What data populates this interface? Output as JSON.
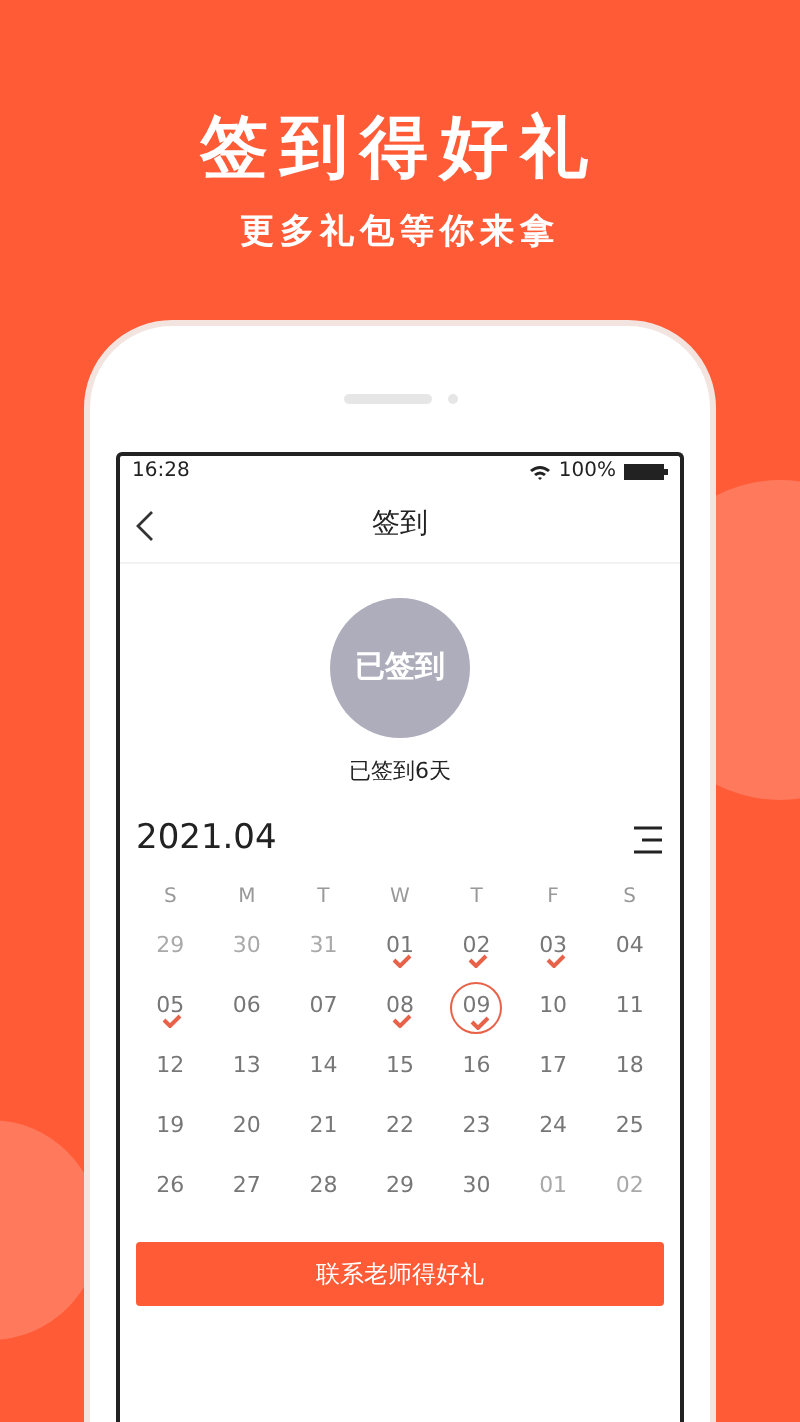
{
  "banner": {
    "title": "签到得好礼",
    "subtitle": "更多礼包等你来拿"
  },
  "status_bar": {
    "time": "16:28",
    "battery": "100%"
  },
  "nav": {
    "title": "签到"
  },
  "checkin": {
    "badge": "已签到",
    "summary": "已签到6天"
  },
  "calendar": {
    "month": "2021.04",
    "weekdays": [
      "S",
      "M",
      "T",
      "W",
      "T",
      "F",
      "S"
    ],
    "weeks": [
      [
        {
          "day": "29",
          "muted": true,
          "checked": false,
          "selected": false
        },
        {
          "day": "30",
          "muted": true,
          "checked": false,
          "selected": false
        },
        {
          "day": "31",
          "muted": true,
          "checked": false,
          "selected": false
        },
        {
          "day": "01",
          "muted": false,
          "checked": true,
          "selected": false
        },
        {
          "day": "02",
          "muted": false,
          "checked": true,
          "selected": false
        },
        {
          "day": "03",
          "muted": false,
          "checked": true,
          "selected": false
        },
        {
          "day": "04",
          "muted": false,
          "checked": false,
          "selected": false
        }
      ],
      [
        {
          "day": "05",
          "muted": false,
          "checked": true,
          "selected": false
        },
        {
          "day": "06",
          "muted": false,
          "checked": false,
          "selected": false
        },
        {
          "day": "07",
          "muted": false,
          "checked": false,
          "selected": false
        },
        {
          "day": "08",
          "muted": false,
          "checked": true,
          "selected": false
        },
        {
          "day": "09",
          "muted": false,
          "checked": true,
          "selected": true
        },
        {
          "day": "10",
          "muted": false,
          "checked": false,
          "selected": false
        },
        {
          "day": "11",
          "muted": false,
          "checked": false,
          "selected": false
        }
      ],
      [
        {
          "day": "12",
          "muted": false,
          "checked": false,
          "selected": false
        },
        {
          "day": "13",
          "muted": false,
          "checked": false,
          "selected": false
        },
        {
          "day": "14",
          "muted": false,
          "checked": false,
          "selected": false
        },
        {
          "day": "15",
          "muted": false,
          "checked": false,
          "selected": false
        },
        {
          "day": "16",
          "muted": false,
          "checked": false,
          "selected": false
        },
        {
          "day": "17",
          "muted": false,
          "checked": false,
          "selected": false
        },
        {
          "day": "18",
          "muted": false,
          "checked": false,
          "selected": false
        }
      ],
      [
        {
          "day": "19",
          "muted": false,
          "checked": false,
          "selected": false
        },
        {
          "day": "20",
          "muted": false,
          "checked": false,
          "selected": false
        },
        {
          "day": "21",
          "muted": false,
          "checked": false,
          "selected": false
        },
        {
          "day": "22",
          "muted": false,
          "checked": false,
          "selected": false
        },
        {
          "day": "23",
          "muted": false,
          "checked": false,
          "selected": false
        },
        {
          "day": "24",
          "muted": false,
          "checked": false,
          "selected": false
        },
        {
          "day": "25",
          "muted": false,
          "checked": false,
          "selected": false
        }
      ],
      [
        {
          "day": "26",
          "muted": false,
          "checked": false,
          "selected": false
        },
        {
          "day": "27",
          "muted": false,
          "checked": false,
          "selected": false
        },
        {
          "day": "28",
          "muted": false,
          "checked": false,
          "selected": false
        },
        {
          "day": "29",
          "muted": false,
          "checked": false,
          "selected": false
        },
        {
          "day": "30",
          "muted": false,
          "checked": false,
          "selected": false
        },
        {
          "day": "01",
          "muted": true,
          "checked": false,
          "selected": false
        },
        {
          "day": "02",
          "muted": true,
          "checked": false,
          "selected": false
        }
      ]
    ]
  },
  "action_button": {
    "label": "联系老师得好礼"
  }
}
